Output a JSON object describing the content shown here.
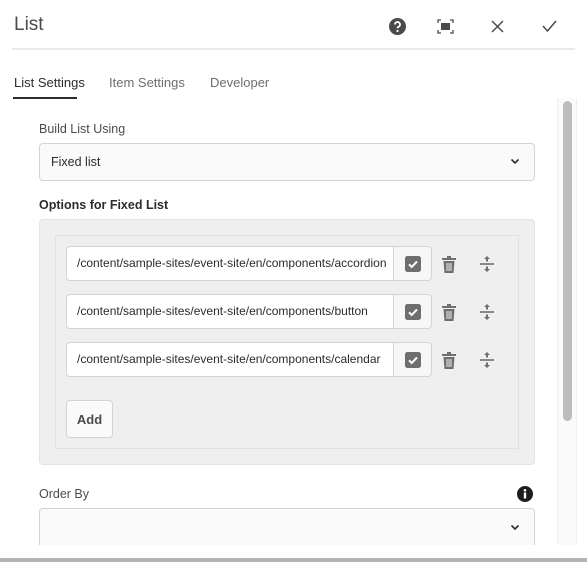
{
  "dialog": {
    "title": "List",
    "icons": [
      "help-icon",
      "fullscreen-icon",
      "close-icon",
      "done-icon"
    ]
  },
  "tabs": [
    {
      "label": "List Settings",
      "active": true
    },
    {
      "label": "Item Settings",
      "active": false
    },
    {
      "label": "Developer",
      "active": false
    }
  ],
  "build_list": {
    "label": "Build List Using",
    "value": "Fixed list"
  },
  "fixed_list": {
    "label": "Options for Fixed List",
    "items": [
      {
        "path": "/content/sample-sites/event-site/en/components/accordion",
        "checked": true
      },
      {
        "path": "/content/sample-sites/event-site/en/components/button",
        "checked": true
      },
      {
        "path": "/content/sample-sites/event-site/en/components/calendar",
        "checked": true
      }
    ],
    "add_label": "Add"
  },
  "order_by": {
    "label": "Order By",
    "value": ""
  }
}
